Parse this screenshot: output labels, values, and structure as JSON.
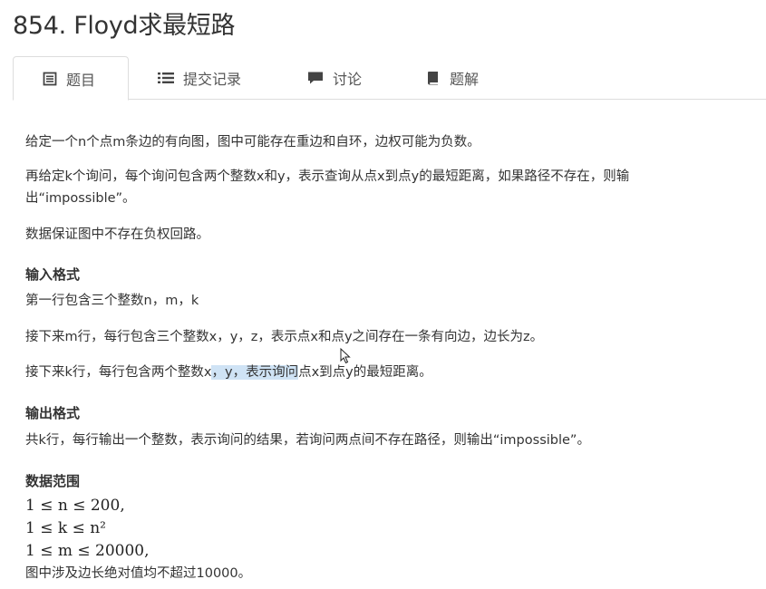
{
  "title": "854. Floyd求最短路",
  "tabs": [
    {
      "label": "题目",
      "icon": "document-icon",
      "active": true
    },
    {
      "label": "提交记录",
      "icon": "list-icon",
      "active": false
    },
    {
      "label": "讨论",
      "icon": "chat-icon",
      "active": false
    },
    {
      "label": "题解",
      "icon": "book-icon",
      "active": false
    }
  ],
  "problem": {
    "desc1": "给定一个n个点m条边的有向图，图中可能存在重边和自环，边权可能为负数。",
    "desc2_line1": "再给定k个询问，每个询问包含两个整数x和y，表示查询从点x到点y的最短距离，如果路径不存在，则输",
    "desc2_line2": "出“impossible”。",
    "desc3": "数据保证图中不存在负权回路。",
    "input_heading": "输入格式",
    "input1": "第一行包含三个整数n，m，k",
    "input2": "接下来m行，每行包含三个整数x，y，z，表示点x和点y之间存在一条有向边，边长为z。",
    "input3_pre": "接下来k行，每行包含两个整数x",
    "input3_sel": "，y，表示询问",
    "input3_post": "点x到点y的最短距离。",
    "output_heading": "输出格式",
    "output1": "共k行，每行输出一个整数，表示询问的结果，若询问两点间不存在路径，则输出“impossible”。",
    "range_heading": "数据范围",
    "range1": "1 ≤ n ≤ 200,",
    "range2": "1 ≤ k ≤ n²",
    "range3": "1 ≤ m ≤ 20000,",
    "range4": "图中涉及边长绝对值均不超过10000。"
  },
  "colors": {
    "selection": "#cfe3f5",
    "border": "#dddddd"
  }
}
